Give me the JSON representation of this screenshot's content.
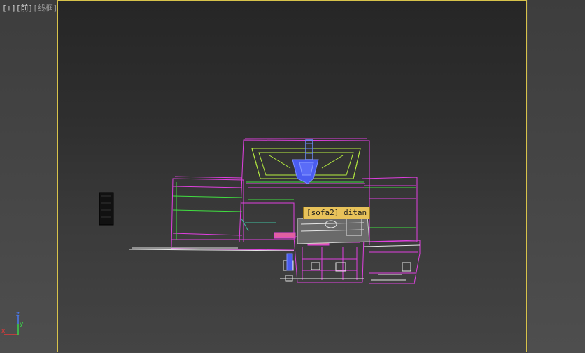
{
  "viewport": {
    "label_plus": "[+]",
    "label_view": "[前]",
    "label_mode": "[线框]"
  },
  "tooltip": {
    "text": "[sofa2] ditan"
  },
  "axes": {
    "x_label": "x",
    "y_label": "y",
    "z_label": "z",
    "x_color": "#e03a3a",
    "y_color": "#3ad84a",
    "z_color": "#4a7af0"
  },
  "colors": {
    "frame_border": "#d7c24a",
    "wire_magenta": "#e040e0",
    "wire_green": "#40e040",
    "wire_yellowgreen": "#b8f040",
    "wire_blue": "#4a5cf0",
    "wire_white": "#e6e6e6",
    "wire_teal": "#40c0a0",
    "tooltip_bg": "#e8c25a"
  }
}
